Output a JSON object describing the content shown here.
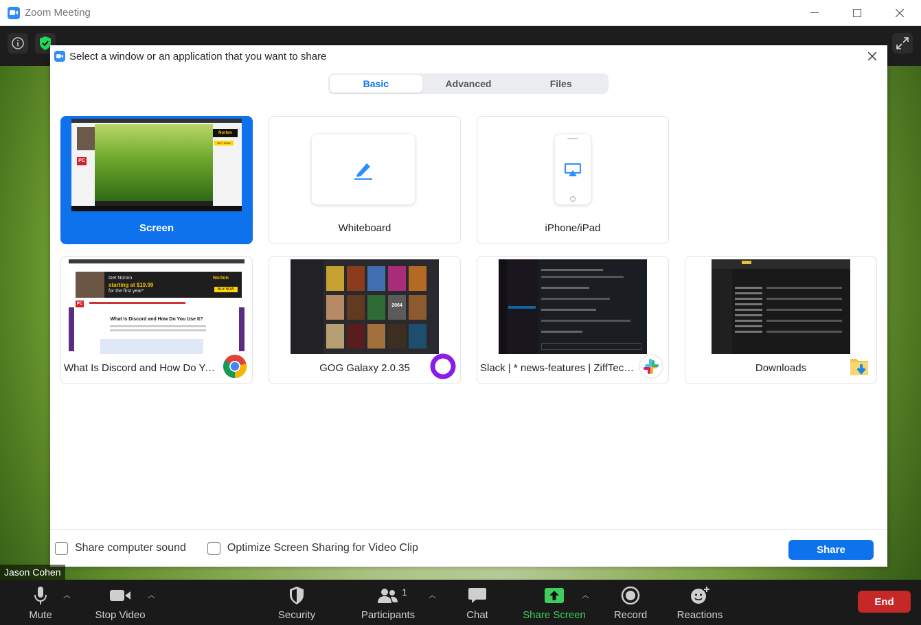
{
  "window": {
    "title": "Zoom Meeting"
  },
  "dialog": {
    "title": "Select a window or an application that you want to share",
    "tabs": [
      {
        "label": "Basic",
        "active": true
      },
      {
        "label": "Advanced",
        "active": false
      },
      {
        "label": "Files",
        "active": false
      }
    ],
    "cards": [
      {
        "label": "Screen",
        "selected": true
      },
      {
        "label": "Whiteboard"
      },
      {
        "label": "iPhone/iPad"
      },
      {
        "label": "What Is Discord and How Do You...",
        "app": "chrome-icon"
      },
      {
        "label": "GOG Galaxy 2.0.35",
        "app": "gog-galaxy-icon"
      },
      {
        "label": "Slack | * news-features | ZiffTech |...",
        "app": "slack-icon"
      },
      {
        "label": "Downloads",
        "app": "folder-download-icon"
      }
    ],
    "thumb_text": {
      "norton_promo": "Get Norton",
      "norton_price": "starting at $19.99",
      "norton_term": "for the first year*",
      "norton_brand": "Norton",
      "buy_now": "BUY NOW",
      "pc_logo": "PC",
      "article_title": "What Is Discord and How Do You Use It?",
      "gog_title": "Cyberpunk",
      "game_year": "2064"
    },
    "footer": {
      "share_sound_label": "Share computer sound",
      "optimize_label": "Optimize Screen Sharing for Video Clip",
      "share_button": "Share"
    }
  },
  "participant_name": "Jason Cohen",
  "toolbar": {
    "mute": "Mute",
    "stop_video": "Stop Video",
    "security": "Security",
    "participants": "Participants",
    "participants_count": "1",
    "chat": "Chat",
    "share_screen": "Share Screen",
    "record": "Record",
    "reactions": "Reactions",
    "end": "End"
  },
  "colors": {
    "accent": "#0e72ed",
    "end": "#c62828",
    "share_green": "#3fce5b"
  }
}
